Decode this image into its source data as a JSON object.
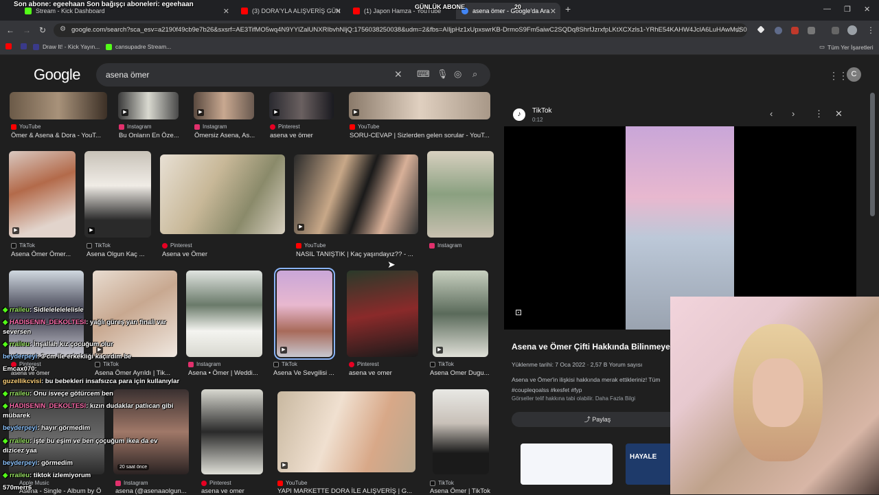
{
  "browser": {
    "tabs": [
      {
        "label": "Stream - Kick Dashboard"
      },
      {
        "label": "(3) DORA'YLA ALIŞVERİŞ GÜN"
      },
      {
        "label": "(1) Japon Hamza - YouTube"
      },
      {
        "label": "asena ömer - Google'da Ara"
      }
    ],
    "new_tab": "+",
    "overlay_top": "Son abone: egeehaan  Son bağışçı aboneleri: egeehaan",
    "overlay_center": "GÜNLÜK ABONE",
    "overlay_count": "20",
    "url": "google.com/search?sca_esv=a2190f49cb9e7b26&sxsrf=AE3TifMO5wq4N9YYlZalUNXRIbvhNljQ:1756038250038&udm=2&fbs=AIljpHz1xUpxswrKB-DrmoS9Fm5aiwC2SQDq8ShrfJzrxfpLKtXCXzls1-YRhE54KAHW4JclA6LuHAwMuS0bl...",
    "bookmarks": [
      "Draw It! - Kick Yayın...",
      "cansupadre Stream..."
    ],
    "all_bookmarks": "Tüm Yer İşaretleri",
    "accent": "#8ab4f8"
  },
  "google": {
    "logo": "Google",
    "query": "asena ömer",
    "avatar": "C"
  },
  "results": {
    "row1": [
      {
        "source": "YouTube",
        "caption": "Ömer & Asena & Dora - YouT..."
      },
      {
        "source": "Instagram",
        "caption": "Bu Onların En Öze..."
      },
      {
        "source": "Instagram",
        "caption": "Ömersiz Asena, As..."
      },
      {
        "source": "Pinterest",
        "caption": "asena ve ömer"
      },
      {
        "source": "YouTube",
        "caption": "SORU-CEVAP | Sizlerden gelen sorular - YouT..."
      }
    ],
    "row2": [
      {
        "source": "TikTok",
        "caption": "Asena Ömer Ömer..."
      },
      {
        "source": "TikTok",
        "caption": "Asena Olgun Kaç ..."
      },
      {
        "source": "Pinterest",
        "caption": "Asena ve Ömer"
      },
      {
        "source": "YouTube",
        "caption": "NASIL TANIŞTIK | Kaç yaşındayız?? - ..."
      },
      {
        "source": "Instagram",
        "caption": ""
      }
    ],
    "row3": [
      {
        "source": "Pinterest",
        "caption": "asena ve ömer"
      },
      {
        "source": "TikTok",
        "caption": "Asena Ömer Ayrıldı | Tik..."
      },
      {
        "source": "Instagram",
        "caption": "Asena • Ömer | Weddi..."
      },
      {
        "source": "TikTok",
        "caption": "Asena Ve Sevgilisi ..."
      },
      {
        "source": "Pinterest",
        "caption": "asena ve omer"
      },
      {
        "source": "TikTok",
        "caption": "Asena Omer Dugu..."
      }
    ],
    "row4": [
      {
        "source": "Apple Music",
        "caption": "Asena - Single - Album by Ö..."
      },
      {
        "source": "Instagram",
        "caption": "asena (@asenaaolgun..."
      },
      {
        "source": "Pinterest",
        "caption": "asena ve omer"
      },
      {
        "source": "YouTube",
        "caption": "YAPI MARKETTE DORA İLE ALIŞVERİŞ | G..."
      },
      {
        "source": "TikTok",
        "caption": "Asena Ömer | TikTok"
      }
    ],
    "badge": "20 saat önce"
  },
  "panel": {
    "source": "TikTok",
    "duration": "0:12",
    "title": "Asena ve Ömer Çifti Hakkında Bilinmeyenler",
    "meta": "Yüklenme tarihi: 7 Oca 2022 · 2,57 B Yorum sayısı",
    "desc": "Asena ve Ömer'in ilişkisi hakkında merak ettikleriniz! Tüm #coupleqoalss #kesfet #fyp",
    "note": "Görseller telif hakkına tabi olabilir. Daha Fazla Bilgi",
    "share": "Paylaş",
    "related": "HAYALE"
  },
  "chat": [
    {
      "user": "rraileu",
      "msg": ": Sidlelelelelelisle",
      "color": "#9be564"
    },
    {
      "user": "HADISENIN_DEKOLTESI",
      "msg": ": yağlı güreş yarı finali var seversen",
      "color": "#ff6fae"
    },
    {
      "user": "rraileu",
      "msg": ": İnşallah kız çocuğum olur",
      "color": "#9be564"
    },
    {
      "user": "beyderpeyi",
      "msg": ": 3 cm ile erkekliği kaçırdım be",
      "color": "#8ec5ff"
    },
    {
      "user": "Emcax070",
      "msg": ":",
      "color": "#ffffff"
    },
    {
      "user": "guzellikcvisi",
      "msg": ": bu bebekleri insafsızca para için kullanıylar",
      "color": "#ffd27a"
    },
    {
      "user": "rraileu",
      "msg": ": Onu isveçe götürcem ben",
      "color": "#9be564"
    },
    {
      "user": "HADISENIN_DEKOLTESI",
      "msg": ": kızın dudaklar patlıcan gibi mübarek",
      "color": "#ff6fae"
    },
    {
      "user": "beyderpeyi",
      "msg": ": hayır görmedim",
      "color": "#8ec5ff"
    },
    {
      "user": "rraileu",
      "msg": ": işte bu eşim ve ben çoçuğum ikea da ev dizicez yaa",
      "color": "#9be564"
    },
    {
      "user": "beyderpeyi",
      "msg": ": görmedim",
      "color": "#8ec5ff"
    },
    {
      "user": "rraileu",
      "msg": ": tiktok izlemiyorum",
      "color": "#9be564"
    }
  ],
  "stream_counter": "570merr6"
}
